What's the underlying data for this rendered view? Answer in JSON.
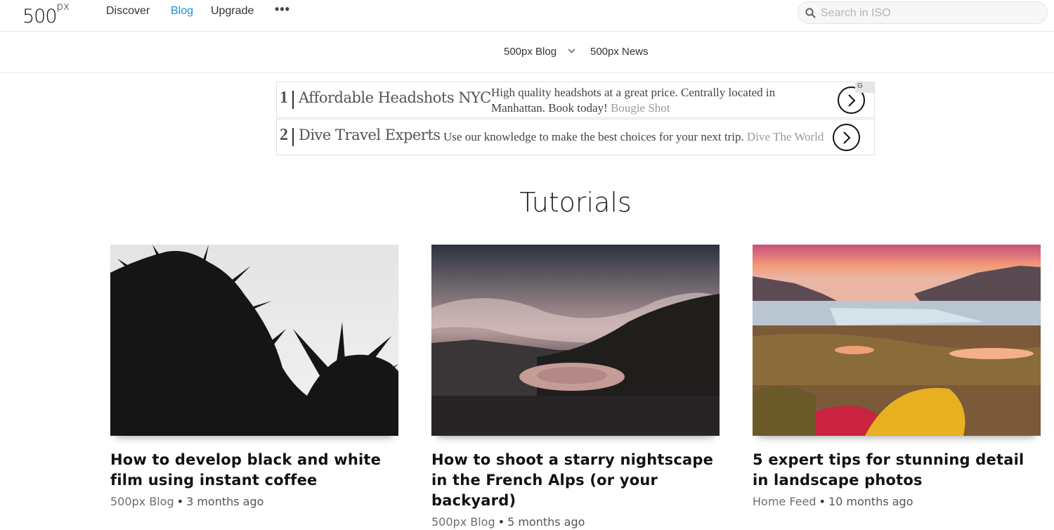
{
  "header": {
    "logo": "500",
    "logo_suffix": "px",
    "nav": [
      {
        "label": "Discover"
      },
      {
        "label": "Blog"
      },
      {
        "label": "Upgrade"
      }
    ],
    "more": "•••",
    "search_placeholder": "Search in ISO"
  },
  "subnav": {
    "blog": "500px Blog",
    "news": "500px News"
  },
  "ads": [
    {
      "num": "1",
      "title": "Affordable Headshots NYC",
      "desc": "High quality headshots at a great price. Centrally located in Manhattan. Book today!",
      "source": "Bougie Shot"
    },
    {
      "num": "2",
      "title": "Dive Travel Experts",
      "desc": "Use our knowledge to make the best choices for your next trip.",
      "source": "Dive The World"
    }
  ],
  "section_title": "Tutorials",
  "cards": [
    {
      "title": "How to develop black and white film using instant coffee",
      "source": "500px Blog",
      "age": "3 months ago"
    },
    {
      "title": "How to shoot a starry nightscape in the French Alps (or your backyard)",
      "source": "500px Blog",
      "age": "5 months ago"
    },
    {
      "title": "5 expert tips for stunning detail in landscape photos",
      "source": "Home Feed",
      "age": "10 months ago"
    }
  ],
  "meta_separator": "•",
  "colors": {
    "accent": "#1a8fd6"
  }
}
